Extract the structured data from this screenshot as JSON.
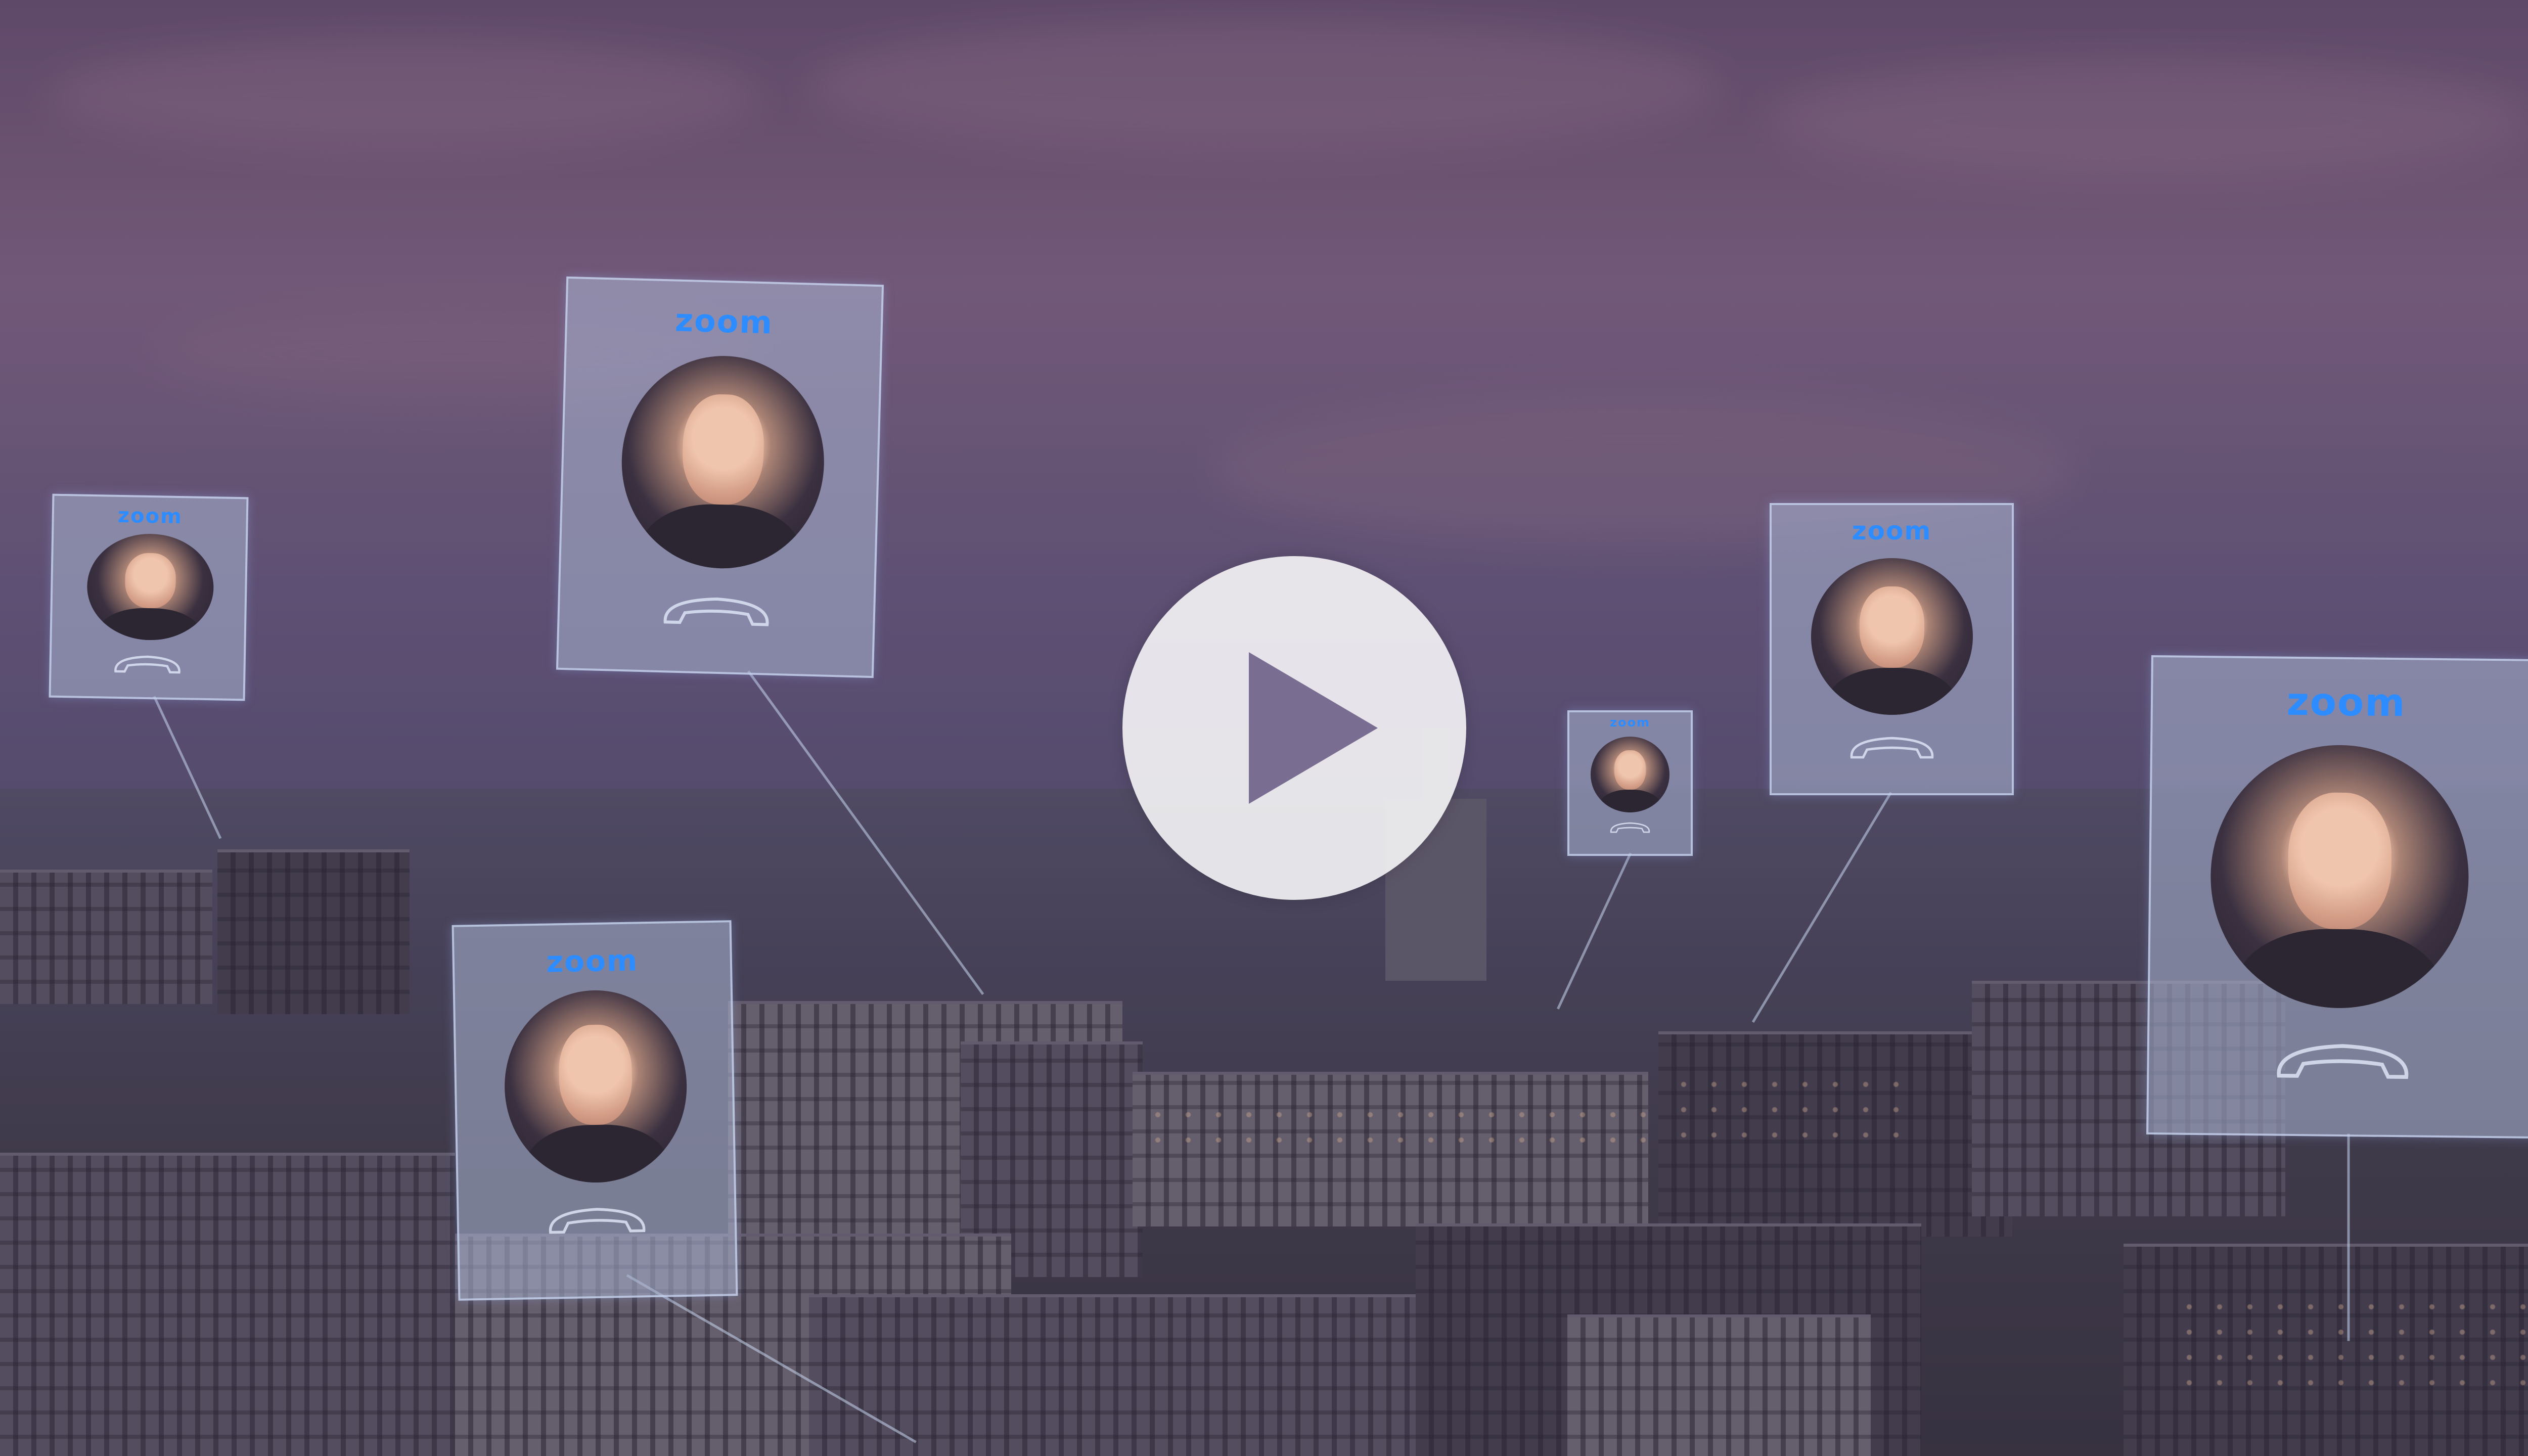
{
  "video": {
    "play_button_icon": "play-icon",
    "accent_color": "#2d8cff"
  },
  "cards": [
    {
      "logo": "zoom",
      "call_icon": "phone-handset-icon"
    },
    {
      "logo": "zoom",
      "call_icon": "phone-handset-icon"
    },
    {
      "logo": "zoom",
      "call_icon": "phone-handset-icon"
    },
    {
      "logo": "zoom",
      "call_icon": "phone-handset-icon"
    },
    {
      "logo": "zoom",
      "call_icon": "phone-handset-icon"
    },
    {
      "logo": "zoom",
      "call_icon": "phone-handset-icon"
    }
  ]
}
